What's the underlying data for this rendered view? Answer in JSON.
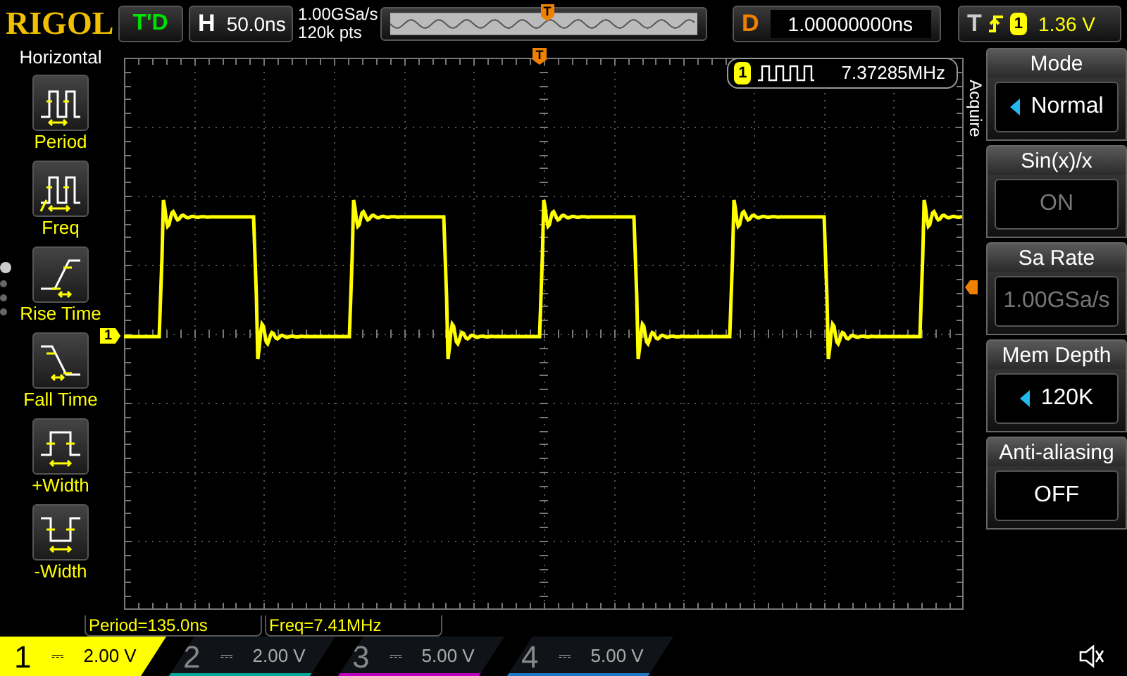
{
  "brand": "RIGOL",
  "run_status": "T'D",
  "horizontal": {
    "label": "H",
    "timebase": "50.0ns",
    "sample_rate": "1.00GSa/s",
    "points": "120k pts",
    "overview_marker": "T"
  },
  "delay": {
    "label": "D",
    "value": "1.00000000ns"
  },
  "trigger": {
    "label": "T",
    "source": "1",
    "level": "1.36 V"
  },
  "left_menu": {
    "title": "Horizontal",
    "items": [
      {
        "kind": "period",
        "label": "Period"
      },
      {
        "kind": "freq",
        "label": "Freq"
      },
      {
        "kind": "rise",
        "label": "Rise Time"
      },
      {
        "kind": "fall",
        "label": "Fall Time"
      },
      {
        "kind": "pwidth",
        "label": "+Width"
      },
      {
        "kind": "nwidth",
        "label": "-Width"
      }
    ],
    "pages": [
      {
        "selected": true
      },
      {
        "selected": false
      },
      {
        "selected": false
      },
      {
        "selected": false
      }
    ]
  },
  "display": {
    "trigger_position_marker": "T",
    "channel_marker": "1",
    "counter": {
      "channel": "1",
      "value": "7.37285MHz"
    }
  },
  "right_menu": {
    "title": "Acquire",
    "items": [
      {
        "label": "Mode",
        "value": "Normal",
        "arrow": true,
        "disabled": false
      },
      {
        "label": "Sin(x)/x",
        "value": "ON",
        "arrow": false,
        "disabled": true
      },
      {
        "label": "Sa Rate",
        "value": "1.00GSa/s",
        "arrow": false,
        "disabled": true
      },
      {
        "label": "Mem Depth",
        "value": "120K",
        "arrow": true,
        "disabled": false
      },
      {
        "label": "Anti-aliasing",
        "value": "OFF",
        "arrow": false,
        "disabled": false
      }
    ]
  },
  "measurements": [
    "Period=135.0ns",
    "Freq=7.41MHz"
  ],
  "channels": [
    {
      "number": "1",
      "coupling": "⎓",
      "scale": "2.00 V",
      "selected": true,
      "color": "#ffff00"
    },
    {
      "number": "2",
      "coupling": "⎓",
      "scale": "2.00 V",
      "selected": false,
      "color": "#00a89a"
    },
    {
      "number": "3",
      "coupling": "⎓",
      "scale": "5.00 V",
      "selected": false,
      "color": "#c000c0"
    },
    {
      "number": "4",
      "coupling": "⎓",
      "scale": "5.00 V",
      "selected": false,
      "color": "#1e78c8"
    }
  ]
}
